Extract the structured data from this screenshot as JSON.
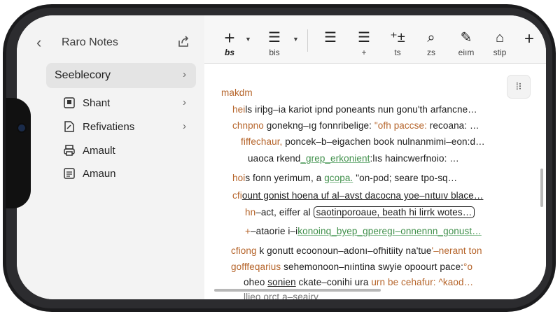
{
  "sidebar": {
    "title": "Raro Notes",
    "back_icon": "chevron-left-icon",
    "share_icon": "share-icon",
    "items": [
      {
        "label": "Seeblecory",
        "icon": "",
        "selected": true
      },
      {
        "label": "Shant",
        "icon": "note-icon"
      },
      {
        "label": "Refivatiens",
        "icon": "document-edit-icon"
      },
      {
        "label": "Amault",
        "icon": "printer-icon"
      },
      {
        "label": "Amaun",
        "icon": "document-lines-icon"
      }
    ]
  },
  "toolbar": {
    "items": [
      {
        "glyph": "+",
        "label": "bs",
        "icon": "add-icon"
      },
      {
        "glyph": "☰",
        "label": "bis",
        "icon": "list-icon"
      },
      {
        "glyph": "☰",
        "label": "",
        "icon": "bullet-list-icon"
      },
      {
        "glyph": "☰",
        "label": "+",
        "icon": "numbered-list-icon"
      },
      {
        "glyph": "⁺±",
        "label": "ts",
        "icon": "sparkle-icon"
      },
      {
        "glyph": "⌕",
        "label": "zs",
        "icon": "search-text-icon"
      },
      {
        "glyph": "✎",
        "label": "eiım",
        "icon": "pen-icon"
      },
      {
        "glyph": "⌂",
        "label": "stip",
        "icon": "lock-icon"
      },
      {
        "glyph": "+",
        "label": "",
        "icon": "plus-icon"
      }
    ]
  },
  "editor": {
    "side_button": "⁞⁝",
    "heading": "makdm",
    "lines": [
      {
        "a": "hei",
        "b": "ls iriþg–ia kariot ipnd poneants nun gonu",
        "c": "'th arfancne…"
      },
      {
        "a": "chnpno",
        "b": "gonekng–ıg fonnribelige:",
        "c": "\"ofh paccse:",
        "d": "recoana: …"
      },
      {
        "a": "fiffechaur,",
        "b": "poncek–b–eigachen book nulnanmimi",
        "c": "–eon:d…"
      },
      {
        "a": "uaoca rkend",
        "g": "_grep_erkonient",
        "b": ":lıs haincwerfnoio:",
        "c": "…"
      },
      {
        "a": "hoi",
        "b": "s fonn yerimum, a",
        "g": "gcopa.",
        "c": "\"on-pod",
        "d": "; seare tpo-sq…"
      },
      {
        "a": "cfi",
        "b": "ount gonist hoena uf al–avst dacocna yoe–nıtuıv blace…"
      },
      {
        "a": "hn",
        "b": "–act, eiffer al",
        "box": "saotinporoaue, beath hi lirrk wotes…"
      },
      {
        "a": "+",
        "b": "–ataorie i–i",
        "g": "konoinq_byep_gperegı",
        "c": "–onnennn_gonust…"
      },
      {
        "a": "cfiong",
        "b": "k gonutt ecoonoun–adonı–ofhitiity na'tue",
        "c": "'–nerant ton"
      },
      {
        "a": "gofffeqarius",
        "b": "sehemonoon–nıintina swyie opoourt pace:",
        "c": "°o"
      },
      {
        "a": "oheo",
        "u": "sonien",
        "b": "ckate–conihi ura",
        "c": "urn be cehafur: ^kaod…"
      },
      {
        "a": "llieo",
        "b": "orct a–seairv"
      }
    ]
  },
  "colors": {
    "accent_orange": "#b5642a",
    "accent_green": "#3f8f4a"
  }
}
